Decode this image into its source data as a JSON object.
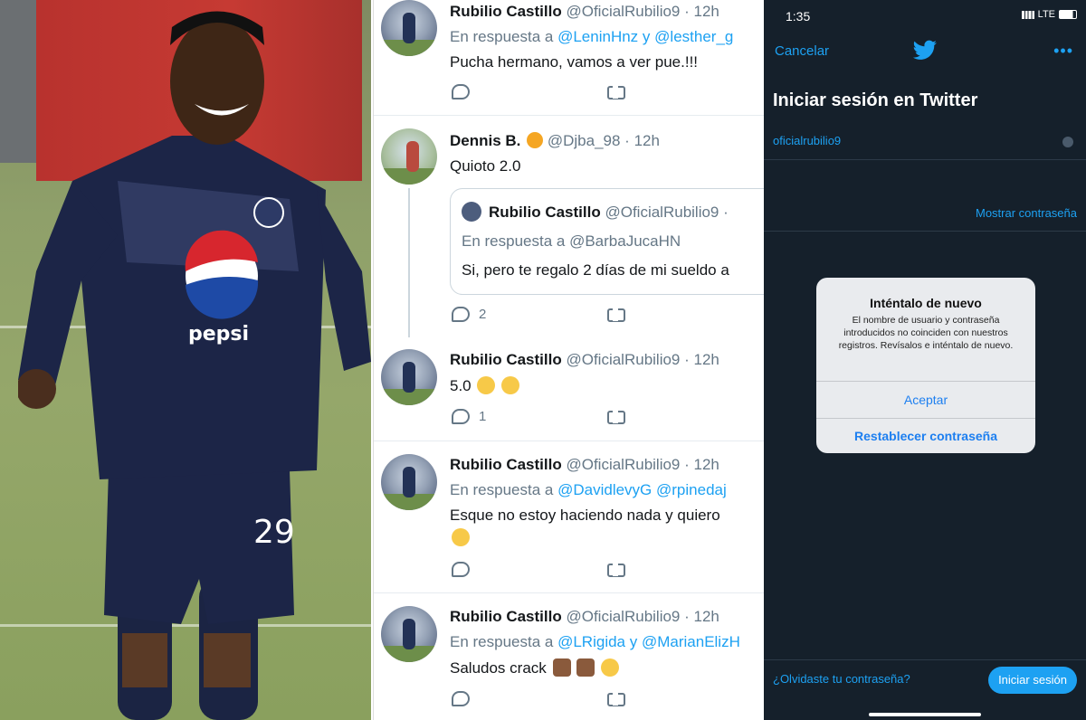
{
  "feed": {
    "tweets": [
      {
        "name": "Rubilio Castillo",
        "handle": "@OficialRubilio9 · 12h",
        "reply_prefix": "En respuesta a",
        "mention1": "@LeninHnz",
        "joiner": "y",
        "mention2": "@lesther_g",
        "text": "Pucha hermano, vamos a ver pue.!!!"
      },
      {
        "name": "Dennis B.",
        "handle": "@Djba_98 · 12h",
        "text": "Quioto 2.0",
        "reply_count": "2",
        "quote": {
          "name": "Rubilio Castillo",
          "handle": "@OficialRubilio9 ·",
          "reply": "En respuesta a @BarbaJucaHN",
          "text": "Si, pero te regalo 2 días de mi sueldo a"
        }
      },
      {
        "name": "Rubilio Castillo",
        "handle": "@OficialRubilio9 · 12h",
        "text": "5.0",
        "reply_count": "1"
      },
      {
        "name": "Rubilio Castillo",
        "handle": "@OficialRubilio9 · 12h",
        "reply_prefix": "En respuesta a",
        "mention1": "@DavidlevyG",
        "mention2": "@rpinedaj",
        "text": "Esque no estoy haciendo nada y quiero"
      },
      {
        "name": "Rubilio Castillo",
        "handle": "@OficialRubilio9 · 12h",
        "reply_prefix": "En respuesta a",
        "mention1": "@LRigida",
        "joiner": "y",
        "mention2": "@MarianElizH",
        "text": "Saludos crack"
      }
    ]
  },
  "phone": {
    "time": "1:35",
    "network": "LTE",
    "cancel": "Cancelar",
    "title": "Iniciar sesión en Twitter",
    "username": "oficialrubilio9",
    "show_password": "Mostrar contraseña",
    "dialog": {
      "title": "Inténtalo de nuevo",
      "message": "El nombre de usuario y contraseña introducidos no coinciden con nuestros registros. Revísalos e inténtalo de nuevo.",
      "accept": "Aceptar",
      "reset": "Restablecer contraseña"
    },
    "forgot": "¿Olvidaste tu contraseña?",
    "login": "Iniciar sesión"
  },
  "colors": {
    "twitter_blue": "#1da1f2",
    "dark_bg": "#15202b",
    "jersey": "#1c2547"
  },
  "icons": [
    "reply-icon",
    "retweet-icon",
    "twitter-bird-icon",
    "more-dots-icon",
    "signal-icon",
    "battery-icon",
    "verified-icon",
    "clear-icon"
  ]
}
